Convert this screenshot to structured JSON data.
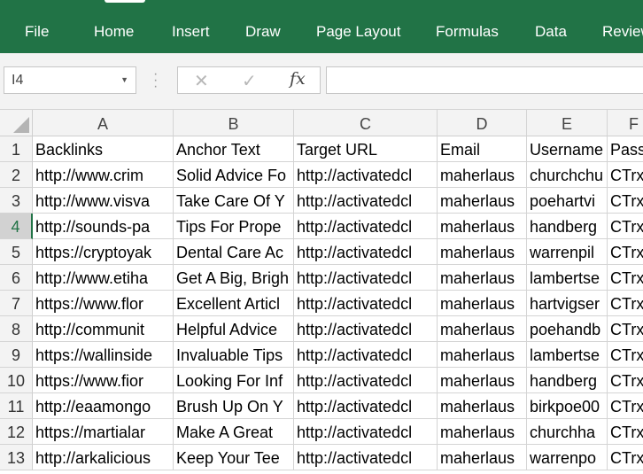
{
  "ribbon": {
    "tabs": [
      "File",
      "Home",
      "Insert",
      "Draw",
      "Page Layout",
      "Formulas",
      "Data",
      "Review"
    ],
    "active_tab": "Home",
    "color": "#217346"
  },
  "formula_bar": {
    "name_box": "I4",
    "cancel_icon": "✕",
    "enter_icon": "✓",
    "fx_label": "fx",
    "formula": ""
  },
  "sheet": {
    "columns": [
      "A",
      "B",
      "C",
      "D",
      "E",
      "F"
    ],
    "selected_row": 4,
    "rows": [
      {
        "num": "1",
        "cells": [
          "Backlinks",
          "Anchor Text",
          "Target URL",
          "Email",
          "Username",
          "Password"
        ]
      },
      {
        "num": "2",
        "cells": [
          "http://www.crim",
          "Solid Advice Fo",
          "http://activatedcl",
          "maherlaus",
          "churchchu",
          "CTrx"
        ]
      },
      {
        "num": "3",
        "cells": [
          "http://www.visva",
          "Take Care Of Y",
          "http://activatedcl",
          "maherlaus",
          "poehartvi",
          "CTrx"
        ]
      },
      {
        "num": "4",
        "cells": [
          "http://sounds-pa",
          "Tips For Prope",
          "http://activatedcl",
          "maherlaus",
          "handberg",
          "CTrx"
        ]
      },
      {
        "num": "5",
        "cells": [
          "https://cryptoyak",
          "Dental Care Ac",
          "http://activatedcl",
          "maherlaus",
          "warrenpil",
          "CTrx"
        ]
      },
      {
        "num": "6",
        "cells": [
          "http://www.etiha",
          "Get A Big, Brigh",
          "http://activatedcl",
          "maherlaus",
          "lambertse",
          "CTrx"
        ]
      },
      {
        "num": "7",
        "cells": [
          "https://www.flor",
          "Excellent Articl",
          "http://activatedcl",
          "maherlaus",
          "hartvigser",
          "CTrx"
        ]
      },
      {
        "num": "8",
        "cells": [
          "http://communit",
          "Helpful Advice",
          "http://activatedcl",
          "maherlaus",
          "poehandb",
          "CTrx"
        ]
      },
      {
        "num": "9",
        "cells": [
          "https://wallinside",
          "Invaluable Tips",
          "http://activatedcl",
          "maherlaus",
          "lambertse",
          "CTrx"
        ]
      },
      {
        "num": "10",
        "cells": [
          "https://www.fior",
          "Looking For Inf",
          "http://activatedcl",
          "maherlaus",
          "handberg",
          "CTrx"
        ]
      },
      {
        "num": "11",
        "cells": [
          "http://eaamongo",
          "Brush Up On Y",
          "http://activatedcl",
          "maherlaus",
          "birkpoe00",
          "CTrx"
        ]
      },
      {
        "num": "12",
        "cells": [
          "https://martialar",
          "Make A Great",
          "http://activatedcl",
          "maherlaus",
          "churchha",
          "CTrx"
        ]
      },
      {
        "num": "13",
        "cells": [
          "http://arkalicious",
          "Keep Your Tee",
          "http://activatedcl",
          "maherlaus",
          "warrenpo",
          "CTrx"
        ]
      }
    ]
  }
}
